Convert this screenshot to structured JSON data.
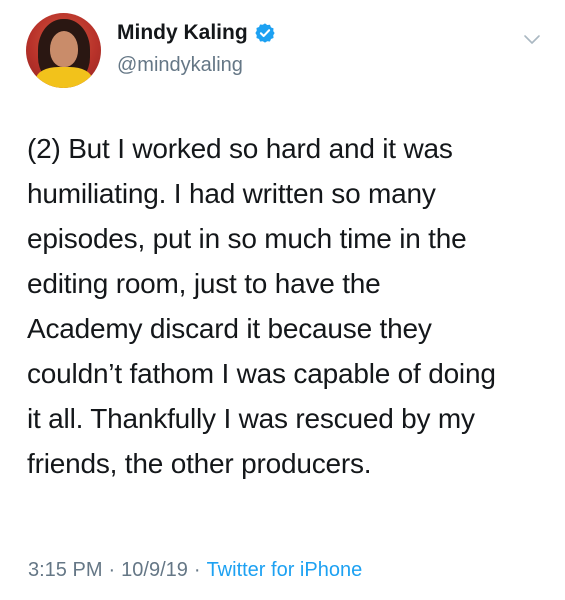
{
  "author": {
    "name": "Mindy Kaling",
    "handle": "@mindykaling",
    "verified": true
  },
  "tweet": {
    "lines": [
      "(2) But I worked so hard and it was",
      "humiliating. I had written so many",
      "episodes, put in so much time in the",
      "editing room, just to have the",
      "Academy discard it because they",
      "couldn’t fathom I was capable of doing",
      "it all. Thankfully I was rescued by my",
      "friends, the other producers."
    ]
  },
  "meta": {
    "time": "3:15 PM",
    "separator": "·",
    "date": "10/9/19",
    "source": "Twitter for iPhone"
  },
  "colors": {
    "text": "#14171a",
    "secondary": "#657786",
    "accent": "#1da1f2"
  },
  "icons": {
    "verified": "verified-badge-icon",
    "chevron": "chevron-down-icon"
  }
}
